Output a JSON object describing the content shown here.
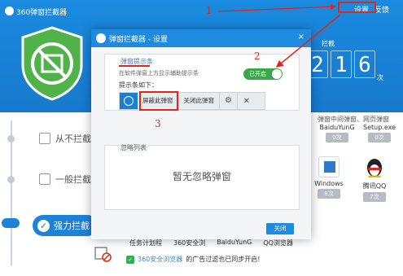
{
  "app": {
    "title": "360弹窗拦截器",
    "top_links": [
      "设置",
      "反馈"
    ]
  },
  "counter": {
    "label": "拦截",
    "digits": [
      "2",
      "1",
      "6"
    ],
    "unit": "次"
  },
  "modes": [
    {
      "label": "从不拦截"
    },
    {
      "label": "一般拦截"
    },
    {
      "label": "强力拦截"
    }
  ],
  "apps_header": "弹窗中间弹窗、网页弹窗",
  "apps": [
    {
      "name": "BaiduYunG",
      "badge": "0次",
      "color": "#6c8cc7"
    },
    {
      "name": "Setup.exe",
      "badge": "0次",
      "color": "#9aa3ad"
    },
    {
      "name": "Windows",
      "badge": "8次",
      "color": "#2f79c8"
    },
    {
      "name": "腾讯QQ",
      "badge": "7次",
      "color": "#f5b400"
    }
  ],
  "bottom_apps": [
    "任务计划程",
    "360安全浏",
    "BaiduYunG",
    "QQ浏览器"
  ],
  "bottom_note": {
    "link": "360安全浏览器",
    "text": "的广告过滤也已同步开启!"
  },
  "dialog": {
    "title": "弹窗拦截器 - 设置",
    "close_symbol": "×",
    "section1_title": "弹窗提示条",
    "section1_desc": "在软件弹窗上方显示辅助提示条",
    "toggle_label": "已开启",
    "bar_label": "提示条如下：",
    "bar_buttons": [
      "屏蔽此弹窗",
      "关闭此弹窗"
    ],
    "section2_title": "忽略列表",
    "empty_text": "暂无忽略弹窗",
    "close_button": "关闭"
  },
  "annotations": [
    "1",
    "2",
    "3"
  ],
  "colors": {
    "brand_blue": "#1a8be0",
    "annotation_red": "#e1261c",
    "toggle_green": "#3aa84a"
  }
}
